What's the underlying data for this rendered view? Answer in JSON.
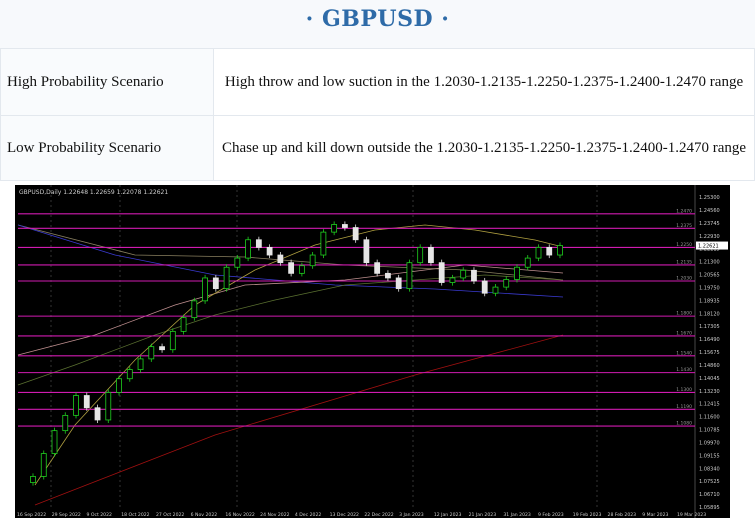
{
  "page": {
    "title": "· GBPUSD ·"
  },
  "scenarios": [
    {
      "label": "High Probability Scenario",
      "text": "High throw and low suction in the 1.2030-1.2135-1.2250-1.2375-1.2400-1.2470 range"
    },
    {
      "label": "Low Probability Scenario",
      "text": "Chase up and kill down outside the 1.2030-1.2135-1.2250-1.2375-1.2400-1.2470 range"
    }
  ],
  "chart": {
    "header": "GBPUSD,Daily  1.22648 1.22659 1.22078 1.22621",
    "colors": {
      "background": "#000000",
      "bull": "#1fd11f",
      "bear": "#e6e6e6",
      "level": "#d01bb0",
      "price_axis_text": "#cccccc"
    },
    "price_ticks": [
      "1.25300",
      "1.24560",
      "1.23745",
      "1.22930",
      "1.22115",
      "1.21300",
      "1.20565",
      "1.19750",
      "1.18935",
      "1.18120",
      "1.17305",
      "1.16490",
      "1.15675",
      "1.14860",
      "1.14045",
      "1.13230",
      "1.12415",
      "1.11600",
      "1.10785",
      "1.09970",
      "1.09155",
      "1.08340",
      "1.07525",
      "1.06710",
      "1.05895"
    ],
    "date_ticks": [
      "16 Sep 2022",
      "29 Sep 2022",
      "9 Oct 2022",
      "18 Oct 2022",
      "27 Oct 2022",
      "6 Nov 2022",
      "16 Nov 2022",
      "24 Nov 2022",
      "4 Dec 2022",
      "13 Dec 2022",
      "22 Dec 2022",
      "3 Jan 2023",
      "12 Jan 2023",
      "21 Jan 2023",
      "31 Jan 2023",
      "9 Feb 2023",
      "19 Feb 2023",
      "28 Feb 2023",
      "9 Mar 2023",
      "19 Mar 2023"
    ],
    "current_price": "1.22621",
    "level_labels": [
      "1.2470",
      "1.2375",
      "1.2250",
      "1.2135",
      "1.2030",
      "1.1800",
      "1.1670",
      "1.1540",
      "1.1430",
      "1.1300",
      "1.1190",
      "1.1080"
    ]
  },
  "chart_data": {
    "type": "candlestick",
    "title": "GBPUSD,Daily  1.22648 1.22659 1.22078 1.22621",
    "ylim": [
      1.055,
      1.258
    ],
    "grid": false,
    "horizontal_levels": [
      1.247,
      1.2375,
      1.225,
      1.2135,
      1.203,
      1.18,
      1.167,
      1.154,
      1.143,
      1.13,
      1.119,
      1.108
    ],
    "close_path": [
      1.075,
      1.09,
      1.105,
      1.115,
      1.128,
      1.12,
      1.112,
      1.13,
      1.139,
      1.145,
      1.152,
      1.16,
      1.158,
      1.17,
      1.179,
      1.19,
      1.205,
      1.198,
      1.212,
      1.218,
      1.23,
      1.225,
      1.22,
      1.215,
      1.208,
      1.213,
      1.22,
      1.235,
      1.24,
      1.238,
      1.23,
      1.215,
      1.208,
      1.205,
      1.198,
      1.215,
      1.225,
      1.215,
      1.202,
      1.205,
      1.21,
      1.203,
      1.195,
      1.199,
      1.204,
      1.212,
      1.218,
      1.225,
      1.22,
      1.2262
    ]
  }
}
